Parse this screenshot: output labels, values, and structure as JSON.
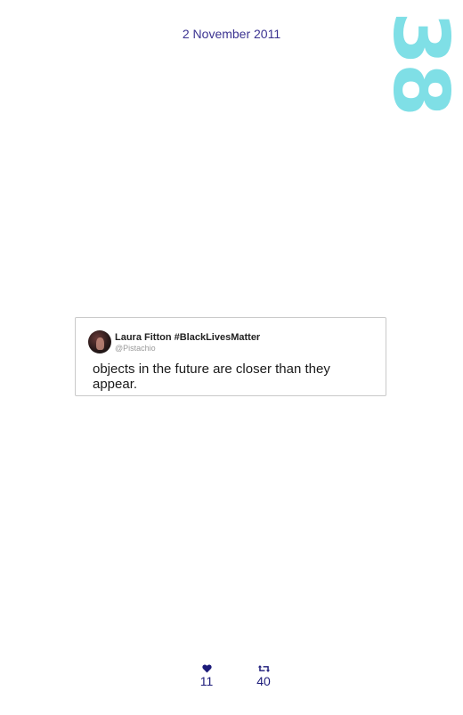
{
  "date": "2 November 2011",
  "entry_number": "38",
  "tweet": {
    "author_name": "Laura Fitton #BlackLivesMatter",
    "author_handle": "@Pistachio",
    "text": "objects in the future are closer than they appear."
  },
  "stats": {
    "likes_count": "11",
    "retweets_count": "40"
  },
  "colors": {
    "date_text": "#3b3391",
    "entry_number": "#7fdfe6",
    "stats": "#1c1b7a",
    "card_border": "#c9c9c9"
  },
  "icons": {
    "likes": "heart-icon",
    "retweets": "retweet-icon"
  }
}
